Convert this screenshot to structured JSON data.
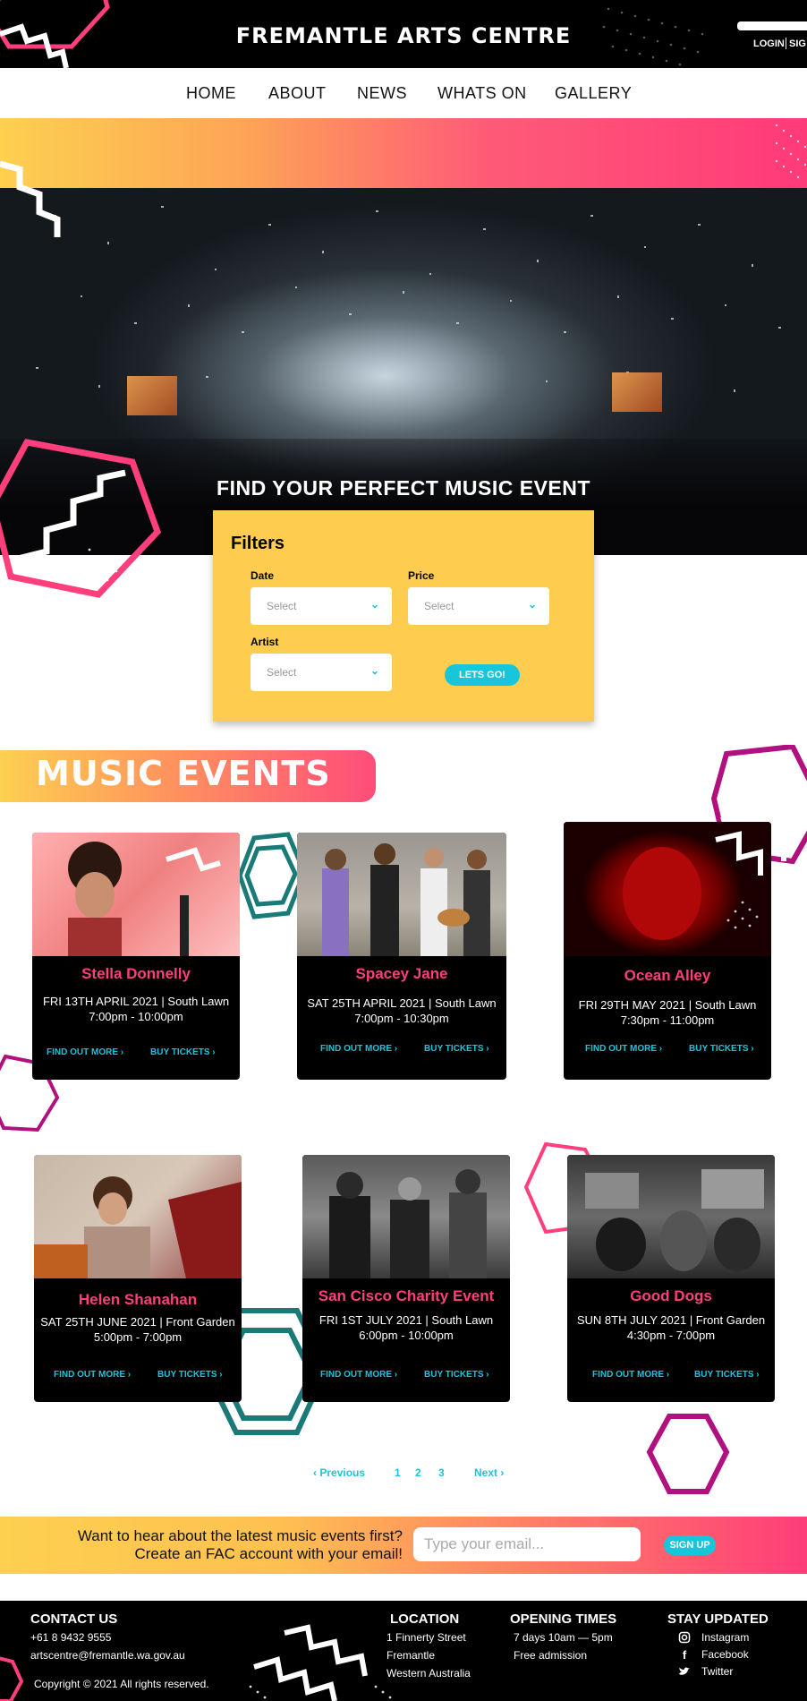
{
  "header": {
    "site_title": "FREMANTLE ARTS CENTRE",
    "login": "LOGIN",
    "signup": "SIG"
  },
  "nav": {
    "items": [
      "HOME",
      "ABOUT",
      "NEWS",
      "WHATS ON",
      "GALLERY"
    ]
  },
  "hero": {
    "heading": "FIND YOUR PERFECT MUSIC EVENT"
  },
  "filters": {
    "title": "Filters",
    "date_label": "Date",
    "date_value": "Select",
    "price_label": "Price",
    "price_value": "Select",
    "artist_label": "Artist",
    "artist_value": "Select",
    "submit_label": "LETS GO!"
  },
  "events": {
    "heading": "MUSIC EVENTS",
    "find_out_more": "FIND OUT MORE",
    "buy_tickets": "BUY TICKETS",
    "items": [
      {
        "name": "Stella Donnelly",
        "date": "FRI 13TH APRIL 2021 | South Lawn",
        "time": "7:00pm - 10:00pm"
      },
      {
        "name": "Spacey Jane",
        "date": "SAT 25TH APRIL 2021 | South Lawn",
        "time": "7:00pm - 10:30pm"
      },
      {
        "name": "Ocean Alley",
        "date": "FRI 29TH MAY 2021 | South Lawn",
        "time": "7:30pm - 11:00pm"
      },
      {
        "name": "Helen Shanahan",
        "date": "SAT 25TH JUNE 2021 | Front Garden",
        "time": "5:00pm - 7:00pm"
      },
      {
        "name": "San Cisco Charity Event",
        "date": "FRI 1ST JULY 2021 | South Lawn",
        "time": "6:00pm - 10:00pm"
      },
      {
        "name": "Good Dogs",
        "date": "SUN 8TH JULY 2021 | Front Garden",
        "time": "4:30pm - 7:00pm"
      }
    ]
  },
  "pagination": {
    "previous": "Previous",
    "pages": [
      "1",
      "2",
      "3"
    ],
    "next": "Next"
  },
  "signup": {
    "line1": "Want to hear about the latest music events first?",
    "line2": "Create an FAC account with your email!",
    "placeholder": "Type your email...",
    "button": "SIGN UP"
  },
  "footer": {
    "contact_heading": "CONTACT US",
    "phone": "+61 8 9432 9555",
    "email": "artscentre@fremantle.wa.gov.au",
    "copyright": "Copyright © 2021 All rights reserved.",
    "location_heading": "LOCATION",
    "location_lines": [
      "1 Finnerty Street",
      "Fremantle",
      "Western Australia"
    ],
    "hours_heading": "OPENING TIMES",
    "hours_lines": [
      "7 days 10am — 5pm",
      "Free admission"
    ],
    "social_heading": "STAY UPDATED",
    "social": [
      {
        "label": "Instagram",
        "icon": "instagram-icon"
      },
      {
        "label": "Facebook",
        "icon": "facebook-icon"
      },
      {
        "label": "Twitter",
        "icon": "twitter-icon"
      }
    ]
  },
  "colors": {
    "pink": "#fe3f7c",
    "yellow": "#fecd4f",
    "cyan": "#18c6dc",
    "teal": "#1a7a78",
    "purple": "#b0117f"
  }
}
